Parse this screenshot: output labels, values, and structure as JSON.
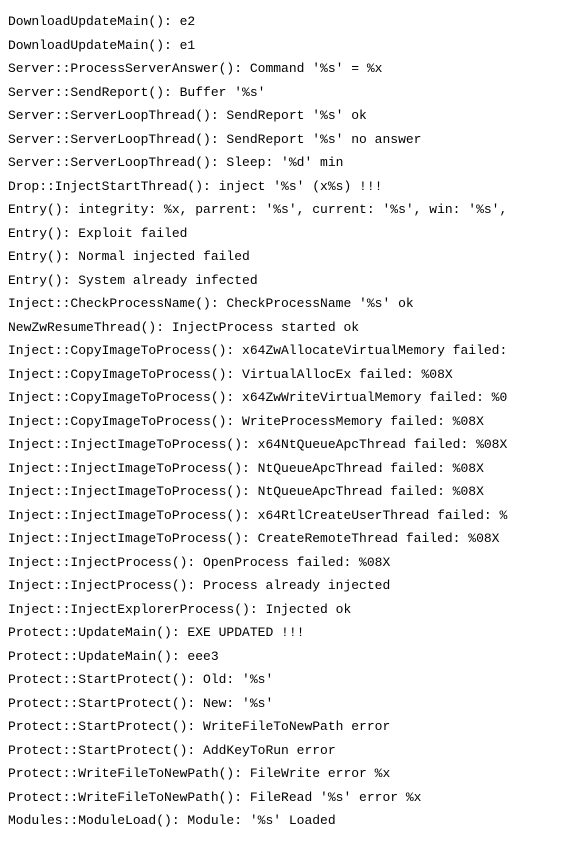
{
  "lines": [
    "DownloadUpdateMain(): e2",
    "DownloadUpdateMain(): e1",
    "Server::ProcessServerAnswer(): Command '%s' = %x",
    "Server::SendReport(): Buffer '%s'",
    "Server::ServerLoopThread(): SendReport '%s' ok",
    "Server::ServerLoopThread(): SendReport '%s' no answer",
    "Server::ServerLoopThread(): Sleep: '%d' min",
    "Drop::InjectStartThread(): inject '%s' (x%s) !!!",
    "Entry(): integrity: %x, parrent: '%s', current: '%s', win: '%s',",
    "Entry(): Exploit failed",
    "Entry(): Normal injected failed",
    "Entry(): System already infected",
    "Inject::CheckProcessName(): CheckProcessName '%s' ok",
    "NewZwResumeThread(): InjectProcess started ok",
    "Inject::CopyImageToProcess(): x64ZwAllocateVirtualMemory failed:",
    "Inject::CopyImageToProcess(): VirtualAllocEx failed: %08X",
    "Inject::CopyImageToProcess(): x64ZwWriteVirtualMemory failed: %0",
    "Inject::CopyImageToProcess(): WriteProcessMemory failed: %08X",
    "Inject::InjectImageToProcess(): x64NtQueueApcThread failed: %08X",
    "Inject::InjectImageToProcess(): NtQueueApcThread failed: %08X",
    "Inject::InjectImageToProcess(): NtQueueApcThread failed: %08X",
    "Inject::InjectImageToProcess(): x64RtlCreateUserThread failed: %",
    "Inject::InjectImageToProcess(): CreateRemoteThread failed: %08X",
    "Inject::InjectProcess(): OpenProcess failed: %08X",
    "Inject::InjectProcess(): Process already injected",
    "Inject::InjectExplorerProcess(): Injected ok",
    "Protect::UpdateMain(): EXE UPDATED !!!",
    "Protect::UpdateMain(): eee3",
    "Protect::StartProtect(): Old: '%s'",
    "Protect::StartProtect(): New: '%s'",
    "Protect::StartProtect(): WriteFileToNewPath error",
    "Protect::StartProtect(): AddKeyToRun error",
    "Protect::WriteFileToNewPath(): FileWrite error %x",
    "Protect::WriteFileToNewPath(): FileRead '%s' error %x",
    "Modules::ModuleLoad(): Module: '%s' Loaded"
  ]
}
